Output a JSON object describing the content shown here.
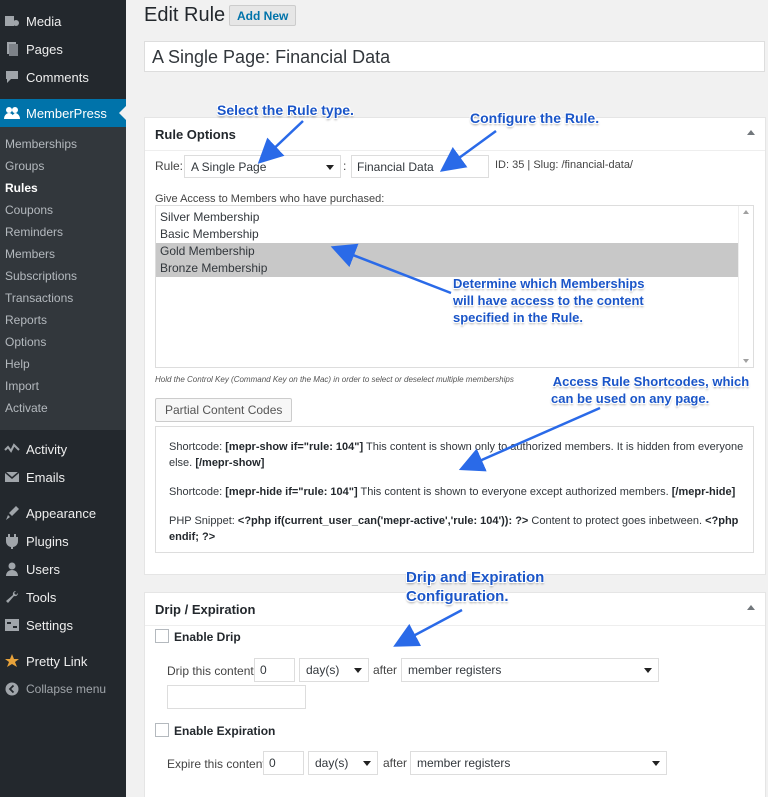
{
  "sidebar": {
    "top_items": [
      {
        "label": "Media",
        "icon": "media-icon"
      },
      {
        "label": "Pages",
        "icon": "pages-icon"
      },
      {
        "label": "Comments",
        "icon": "comments-icon"
      }
    ],
    "memberpress": {
      "label": "MemberPress",
      "icon": "users-icon"
    },
    "submenu": [
      "Memberships",
      "Groups",
      "Rules",
      "Coupons",
      "Reminders",
      "Members",
      "Subscriptions",
      "Transactions",
      "Reports",
      "Options",
      "Help",
      "Import",
      "Activate"
    ],
    "current_sub": "Rules",
    "bottom_items": [
      {
        "label": "Activity",
        "icon": "activity-icon"
      },
      {
        "label": "Emails",
        "icon": "email-icon"
      },
      {
        "label": "Appearance",
        "icon": "appearance-icon"
      },
      {
        "label": "Plugins",
        "icon": "plugins-icon"
      },
      {
        "label": "Users",
        "icon": "user-icon"
      },
      {
        "label": "Tools",
        "icon": "tools-icon"
      },
      {
        "label": "Settings",
        "icon": "settings-icon"
      },
      {
        "label": "Pretty Link",
        "icon": "star-icon"
      }
    ],
    "collapse": "Collapse menu"
  },
  "header": {
    "title": "Edit Rule",
    "add_new": "Add New"
  },
  "post_title": "A Single Page: Financial Data",
  "rule_options": {
    "heading": "Rule Options",
    "rule_label": "Rule:",
    "rule_type": "A Single Page",
    "separator": ":",
    "rule_target": "Financial Data",
    "id_slug": "ID: 35 | Slug: /financial-data/",
    "access_label": "Give Access to Members who have purchased:",
    "memberships": [
      {
        "label": "Silver Membership",
        "selected": false
      },
      {
        "label": "Basic Membership",
        "selected": false
      },
      {
        "label": "Gold Membership",
        "selected": true
      },
      {
        "label": "Bronze Membership",
        "selected": true
      }
    ],
    "hint": "Hold the Control Key (Command Key on the Mac) in order to select or deselect multiple memberships",
    "partial_button": "Partial Content Codes",
    "codes": {
      "show_prefix": "Shortcode:",
      "show_code": "[mepr-show if=\"rule: 104\"]",
      "show_text": "This content is shown only to authorized members. It is hidden from everyone else.",
      "show_close": "[/mepr-show]",
      "hide_prefix": "Shortcode:",
      "hide_code": "[mepr-hide if=\"rule: 104\"]",
      "hide_text": "This content is shown to everyone except authorized members.",
      "hide_close": "[/mepr-hide]",
      "php_prefix": "PHP Snippet:",
      "php_code": "<?php if(current_user_can('mepr-active','rule: 104')): ?>",
      "php_text": "Content to protect goes inbetween.",
      "php_close": "<?php endif; ?>"
    }
  },
  "drip": {
    "heading": "Drip / Expiration",
    "enable_drip": "Enable Drip",
    "drip_label": "Drip this content",
    "drip_value": "0",
    "drip_unit": "day(s)",
    "after": "after",
    "drip_event": "member registers",
    "enable_expiration": "Enable Expiration",
    "expire_label": "Expire this content",
    "expire_value": "0",
    "expire_unit": "day(s)",
    "expire_after": "after",
    "expire_event": "member registers"
  },
  "annotations": {
    "rule_type": "Select the Rule type.",
    "configure": "Configure the Rule.",
    "memberships_1": "Determine which Memberships",
    "memberships_2": "will have access to the content",
    "memberships_3": "specified in the Rule.",
    "shortcodes_1": "Access Rule Shortcodes, which",
    "shortcodes_2": "can be used on any page.",
    "drip_1": "Drip and Expiration",
    "drip_2": "Configuration."
  },
  "colors": {
    "accent": "#0073aa",
    "annotation": "#1a55c8",
    "sidebar": "#23282d"
  }
}
